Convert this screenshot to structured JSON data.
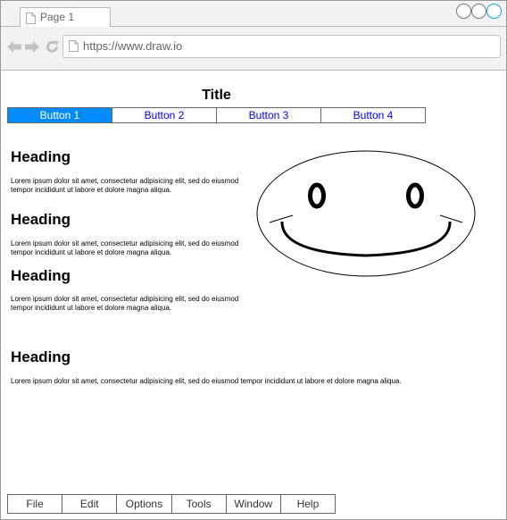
{
  "browser": {
    "tab_label": "Page 1",
    "url": "https://www.draw.io",
    "window_buttons": [
      "minimize",
      "maximize",
      "close"
    ],
    "close_button_color": "#1ba1e2"
  },
  "page": {
    "title": "Title",
    "tabs": [
      {
        "label": "Button 1",
        "active": true
      },
      {
        "label": "Button 2",
        "active": false
      },
      {
        "label": "Button 3",
        "active": false
      },
      {
        "label": "Button 4",
        "active": false
      }
    ],
    "active_tab_color": "#008cff",
    "link_color": "#0000ee",
    "sections": [
      {
        "heading": "Heading",
        "lines": [
          "Lorem ipsum dolor sit amet, consectetur adipisicing elit, sed do eiusmod",
          "tempor incididunt ut labore et dolore magna aliqua."
        ]
      },
      {
        "heading": "Heading",
        "lines": [
          "Lorem ipsum dolor sit amet, consectetur adipisicing elit, sed do eiusmod",
          "tempor incididunt ut labore et dolore magna aliqua."
        ]
      },
      {
        "heading": "Heading",
        "lines": [
          "Lorem ipsum dolor sit amet, consectetur adipisicing elit, sed do eiusmod",
          "tempor incididunt ut labore et dolore magna aliqua."
        ]
      },
      {
        "heading": "Heading",
        "lines": [
          "Lorem ipsum dolor sit amet, consectetur adipisicing elit, sed do eiusmod tempor incididunt ut labore et dolore magna aliqua."
        ]
      }
    ],
    "image_icon": "smiley-face-icon"
  },
  "menubar": {
    "items": [
      "File",
      "Edit",
      "Options",
      "Tools",
      "Window",
      "Help"
    ]
  }
}
